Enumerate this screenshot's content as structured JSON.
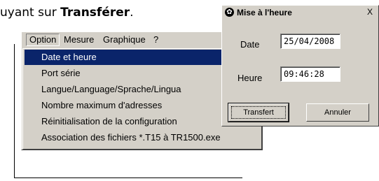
{
  "document": {
    "text_prefix": "uyant sur ",
    "text_bold": "Transférer",
    "text_suffix": "."
  },
  "menubar": {
    "items": [
      "Option",
      "Mesure",
      "Graphique",
      "?"
    ]
  },
  "dropdown": {
    "items": [
      "Date et heure",
      "Port série",
      "Langue/Language/Sprache/Lingua",
      "Nombre maximum d'adresses",
      "Réinitialisation de la configuration",
      "Association des fichiers *.T15 à TR1500.exe"
    ],
    "highlighted_index": 0
  },
  "dialog": {
    "title": "Mise à l'heure",
    "close_label": "X",
    "date_label": "Date",
    "date_value": "25/04/2008",
    "time_label": "Heure",
    "time_value": "09:46:28",
    "transfer_button": "Transfert",
    "cancel_button": "Annuler"
  },
  "colors": {
    "highlight": "#0a246a",
    "face": "#d4d0c8"
  }
}
